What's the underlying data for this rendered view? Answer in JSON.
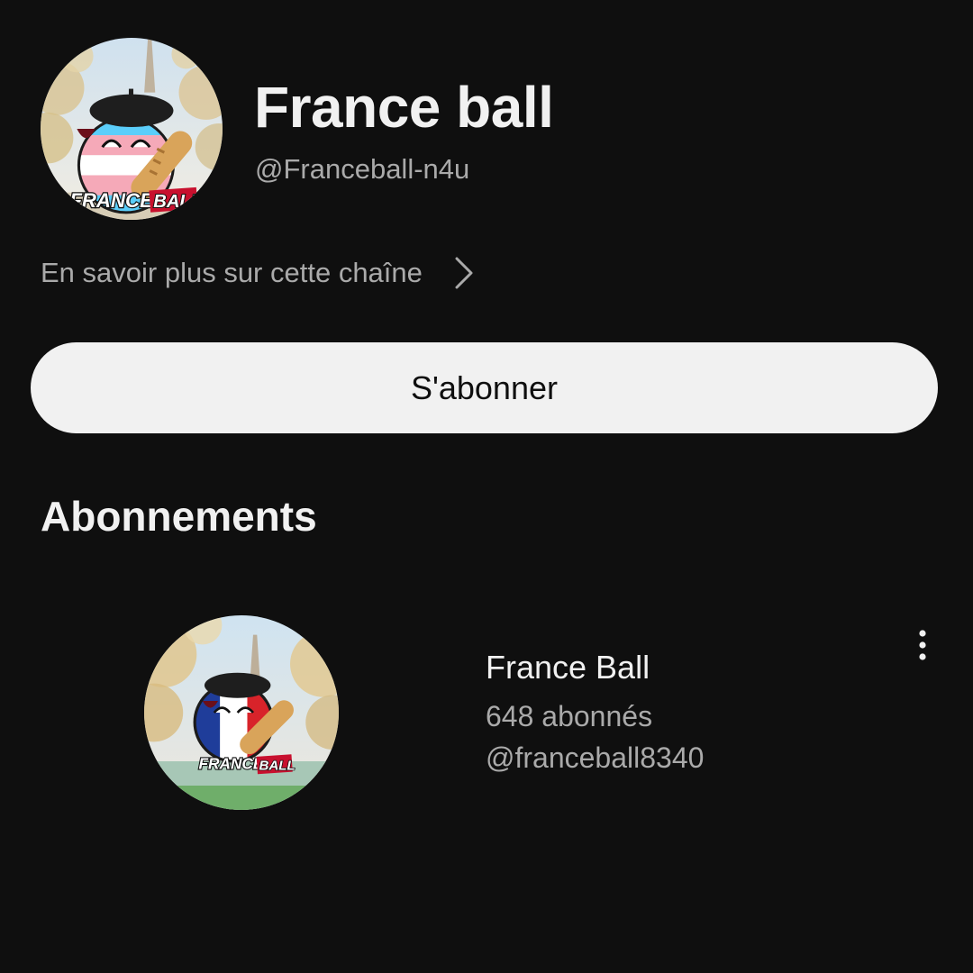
{
  "channel": {
    "name": "France ball",
    "handle": "@Franceball-n4u",
    "avatar_icon": "franceball-trans-flag-avatar",
    "avatar_logo_text": "FRANCE BALL",
    "about_link": "En savoir plus sur cette chaîne",
    "subscribe_label": "S'abonner"
  },
  "subscriptions": {
    "title": "Abonnements",
    "items": [
      {
        "name": "France Ball",
        "subscribers": "648 abonnés",
        "handle": "@franceball8340",
        "avatar_icon": "franceball-french-flag-avatar",
        "avatar_logo_text": "FRANCE BALL",
        "menu_icon": "more-vert-icon"
      }
    ]
  },
  "colors": {
    "background": "#0f0f0f",
    "text_primary": "#f1f1f1",
    "text_secondary": "#aaaaaa",
    "button_bg": "#f1f1f1",
    "button_text": "#0f0f0f"
  }
}
